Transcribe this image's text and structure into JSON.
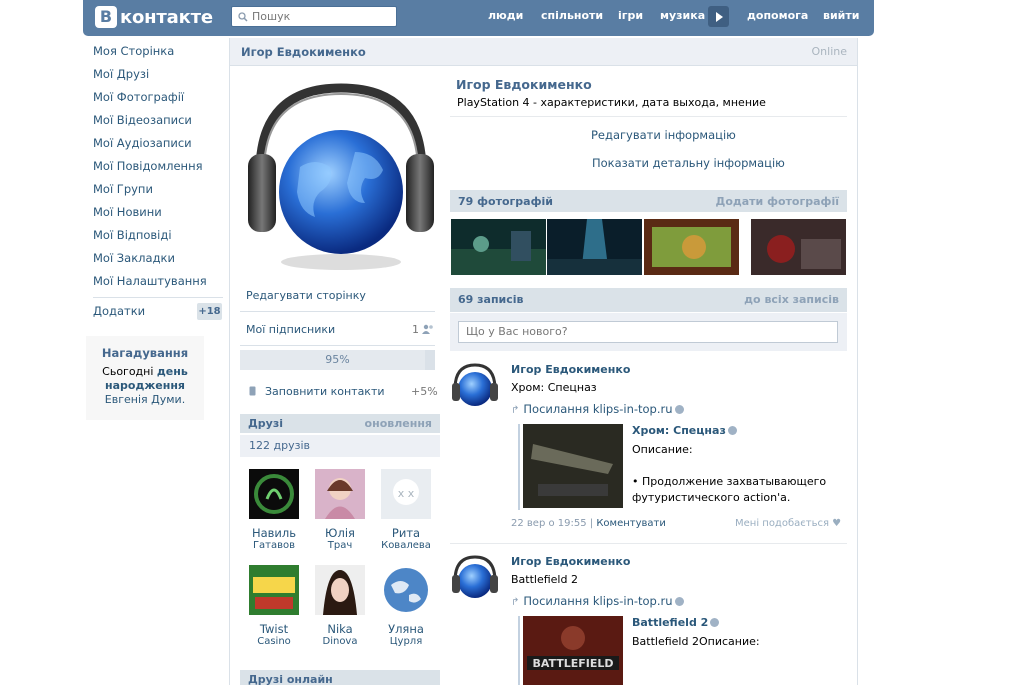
{
  "topbar": {
    "logo_letter": "В",
    "logo_text": "контакте",
    "search_placeholder": "Пошук",
    "nav": [
      "люди",
      "спільноти",
      "ігри",
      "музика",
      "допомога",
      "вийти"
    ]
  },
  "leftmenu": {
    "items": [
      "Моя Сторінка",
      "Мої Друзі",
      "Мої Фотографії",
      "Мої Відеозаписи",
      "Мої Аудіозаписи",
      "Мої Повідомлення",
      "Мої Групи",
      "Мої Новини",
      "Мої Відповіді",
      "Мої Закладки",
      "Мої Налаштування"
    ],
    "apps_label": "Додатки",
    "apps_badge": "+18"
  },
  "reminder": {
    "title": "Нагадування",
    "line1": "Сьогодні",
    "line1_bold": "день",
    "line2": "народження",
    "line3": "Евгенія Думи."
  },
  "profile": {
    "name": "Игор Евдокименко",
    "online": "Online",
    "status": "PlayStation 4 - характеристики, дата выхода, мнение",
    "edit_info": "Редагувати інформацію",
    "show_details": "Показати детальну інформацію"
  },
  "left_column": {
    "edit_page": "Редагувати сторінку",
    "followers_label": "Мої підписники",
    "followers_count": "1",
    "progress_text": "95%",
    "progress_value": 0.95,
    "fill_contacts": "Заповнити контакти",
    "fill_contacts_bonus": "+5%",
    "friends_title": "Друзі",
    "friends_updates": "оновлення",
    "friends_count": "122 друзів",
    "friends": [
      {
        "first": "Навиль",
        "last": "Гатавов"
      },
      {
        "first": "Юлія",
        "last": "Трач"
      },
      {
        "first": "Рита",
        "last": "Ковалева"
      },
      {
        "first": "Twist",
        "last": "Casino"
      },
      {
        "first": "Nika",
        "last": "Dinova"
      },
      {
        "first": "Уляна",
        "last": "Цурля"
      }
    ],
    "friends_online_title": "Друзі онлайн"
  },
  "photos": {
    "title": "79 фотографій",
    "add": "Додати фотографії"
  },
  "wall": {
    "title": "69 записів",
    "all_link": "до всіх записів",
    "whatsnew_placeholder": "Що у Вас нового?",
    "posts": [
      {
        "author": "Игор Евдокименко",
        "text": "Хром: Спецназ",
        "link": "Посилання klips-in-top.ru",
        "quote_title": "Хром: Спецназ",
        "quote_line1": "Описание:",
        "quote_line2": "• Продолжение захватывающего",
        "quote_line3": "футуристического action'a.",
        "date": "22 вер о 19:55",
        "comment": "Коментувати",
        "like": "Мені подобається"
      },
      {
        "author": "Игор Евдокименко",
        "text": "Battlefield 2",
        "link": "Посилання klips-in-top.ru",
        "quote_title": "Battlefield 2",
        "quote_line1": "Battlefield 2Описание:"
      }
    ]
  },
  "colors": {
    "topbar": "#597DA3",
    "link": "#2B587A",
    "header_bg": "#DAE2E8"
  }
}
